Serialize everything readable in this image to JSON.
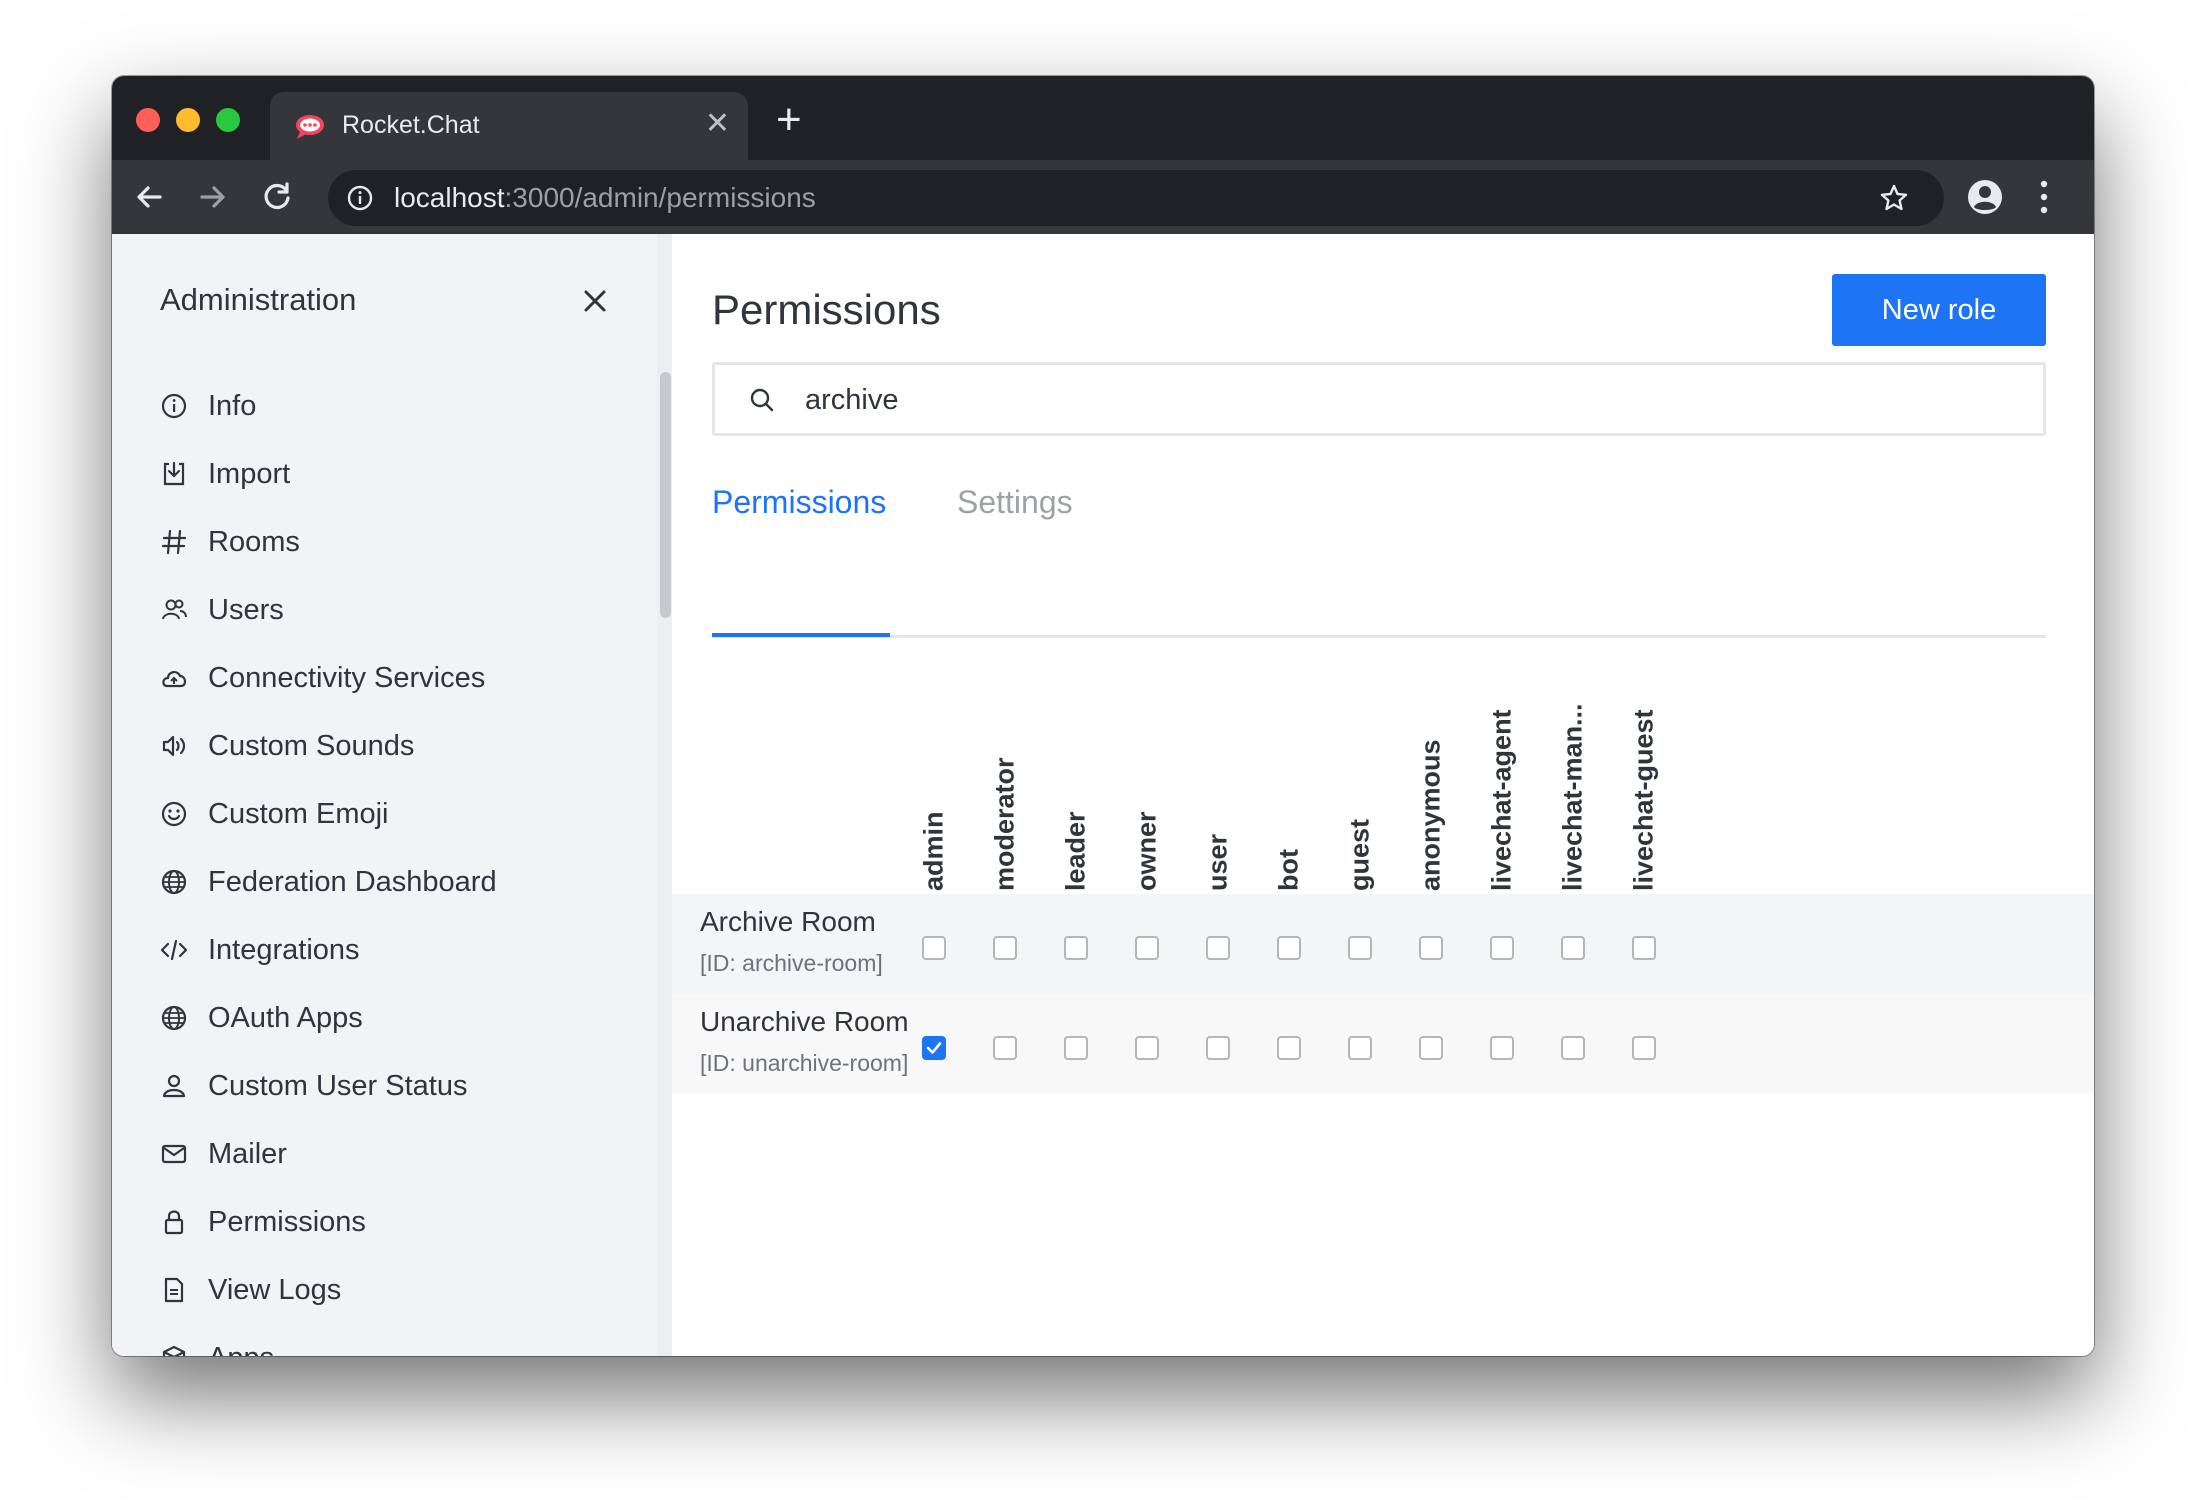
{
  "browser": {
    "tab_title": "Rocket.Chat",
    "url_host": "localhost",
    "url_path": ":3000/admin/permissions"
  },
  "sidebar": {
    "title": "Administration",
    "items": [
      {
        "label": "Info",
        "icon": "info-icon"
      },
      {
        "label": "Import",
        "icon": "import-icon"
      },
      {
        "label": "Rooms",
        "icon": "hashtag-icon"
      },
      {
        "label": "Users",
        "icon": "users-icon"
      },
      {
        "label": "Connectivity Services",
        "icon": "cloud-icon"
      },
      {
        "label": "Custom Sounds",
        "icon": "volume-icon"
      },
      {
        "label": "Custom Emoji",
        "icon": "emoji-icon"
      },
      {
        "label": "Federation Dashboard",
        "icon": "globe-icon"
      },
      {
        "label": "Integrations",
        "icon": "code-icon"
      },
      {
        "label": "OAuth Apps",
        "icon": "globe-icon"
      },
      {
        "label": "Custom User Status",
        "icon": "user-icon"
      },
      {
        "label": "Mailer",
        "icon": "mail-icon"
      },
      {
        "label": "Permissions",
        "icon": "lock-icon"
      },
      {
        "label": "View Logs",
        "icon": "file-icon"
      },
      {
        "label": "Apps",
        "icon": "cube-icon"
      }
    ]
  },
  "main": {
    "title": "Permissions",
    "new_role_label": "New role",
    "search_value": "archive",
    "tabs": [
      {
        "label": "Permissions",
        "active": true
      },
      {
        "label": "Settings",
        "active": false
      }
    ]
  },
  "roles": [
    "admin",
    "moderator",
    "leader",
    "owner",
    "user",
    "bot",
    "guest",
    "anonymous",
    "livechat-agent",
    "livechat-man...",
    "livechat-guest"
  ],
  "permissions": [
    {
      "name": "Archive Room",
      "id": "[ID: archive-room]",
      "granted": [
        false,
        false,
        false,
        false,
        false,
        false,
        false,
        false,
        false,
        false,
        false
      ]
    },
    {
      "name": "Unarchive Room",
      "id": "[ID: unarchive-room]",
      "granted": [
        true,
        false,
        false,
        false,
        false,
        false,
        false,
        false,
        false,
        false,
        false
      ]
    }
  ],
  "colors": {
    "accent": "#1d74f5",
    "text": "#2f343d",
    "sidebar_bg": "#f2f3f5"
  }
}
